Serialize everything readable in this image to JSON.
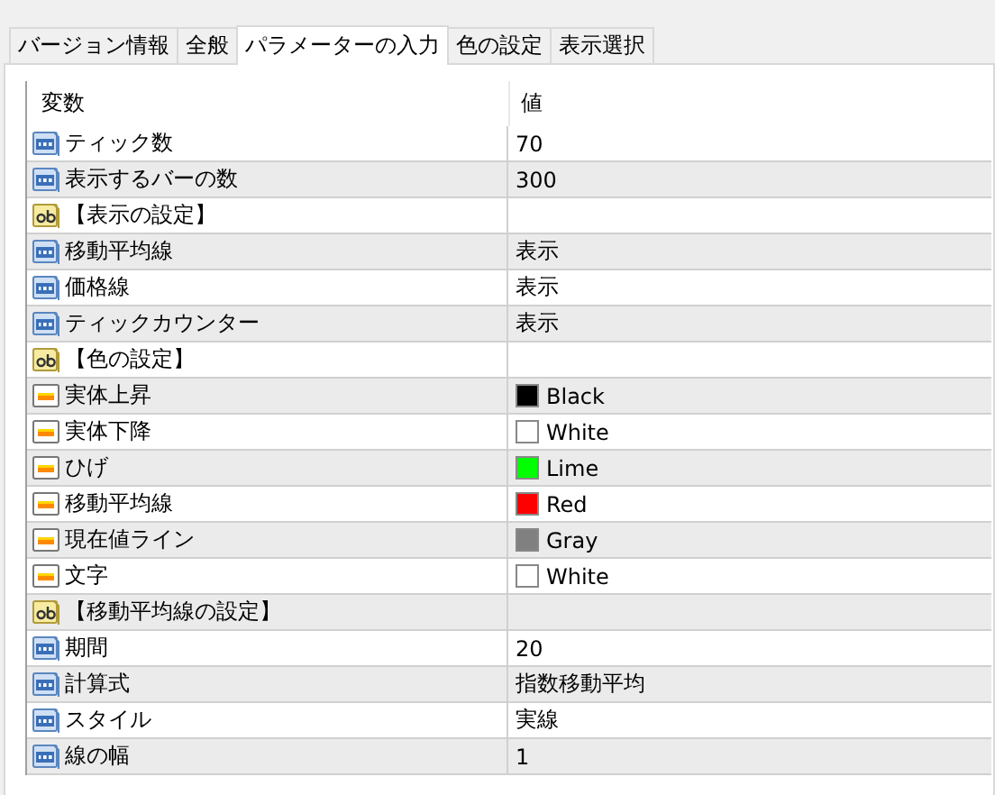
{
  "tabs": [
    {
      "label": "バージョン情報",
      "selected": false
    },
    {
      "label": "全般",
      "selected": false
    },
    {
      "label": "パラメーターの入力",
      "selected": true
    },
    {
      "label": "色の設定",
      "selected": false
    },
    {
      "label": "表示選択",
      "selected": false
    }
  ],
  "table": {
    "columns": [
      "変数",
      "値"
    ],
    "rows": [
      {
        "kind": "number",
        "name": "ティック数",
        "value": "70"
      },
      {
        "kind": "number",
        "name": "表示するバーの数",
        "value": "300"
      },
      {
        "kind": "text",
        "name": "【表示の設定】"
      },
      {
        "kind": "number",
        "name": "移動平均線",
        "value": "表示"
      },
      {
        "kind": "number",
        "name": "価格線",
        "value": "表示"
      },
      {
        "kind": "number",
        "name": "ティックカウンター",
        "value": "表示"
      },
      {
        "kind": "text",
        "name": "【色の設定】"
      },
      {
        "kind": "color",
        "name": "実体上昇",
        "value": "Black",
        "color": "#000000"
      },
      {
        "kind": "color",
        "name": "実体下降",
        "value": "White",
        "color": "#ffffff"
      },
      {
        "kind": "color",
        "name": "ひげ",
        "value": "Lime",
        "color": "#00ff00"
      },
      {
        "kind": "color",
        "name": "移動平均線",
        "value": "Red",
        "color": "#ff0000"
      },
      {
        "kind": "color",
        "name": "現在値ライン",
        "value": "Gray",
        "color": "#808080"
      },
      {
        "kind": "color",
        "name": "文字",
        "value": "White",
        "color": "#ffffff"
      },
      {
        "kind": "text",
        "name": "【移動平均線の設定】"
      },
      {
        "kind": "number",
        "name": "期間",
        "value": "20"
      },
      {
        "kind": "number",
        "name": "計算式",
        "value": "指数移動平均"
      },
      {
        "kind": "number",
        "name": "スタイル",
        "value": "実線"
      },
      {
        "kind": "number",
        "name": "線の幅",
        "value": "1"
      }
    ]
  }
}
